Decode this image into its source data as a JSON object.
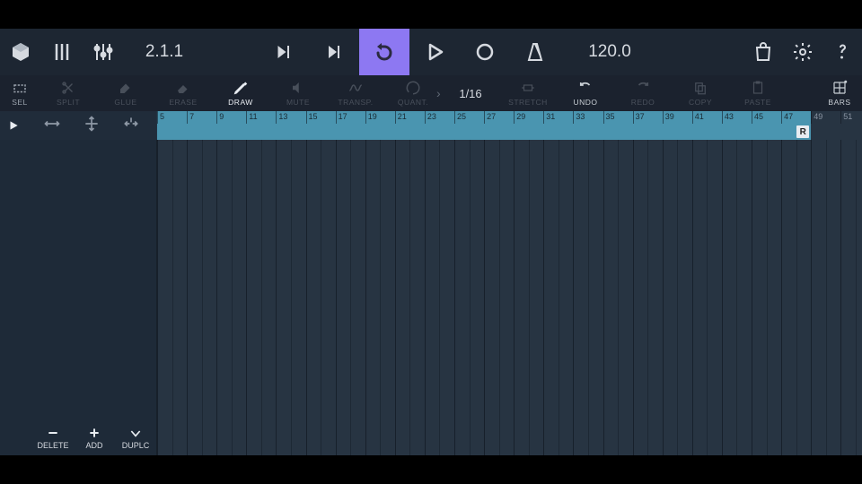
{
  "topbar": {
    "position": "2.1.1",
    "tempo": "120.0"
  },
  "tools": {
    "sel": "SEL",
    "split": "SPLIT",
    "glue": "GLUE",
    "erase": "ERASE",
    "draw": "DRAW",
    "mute": "MUTE",
    "transp": "TRANSP.",
    "quant": "QUANT.",
    "snap": "1/16",
    "stretch": "STRETCH",
    "undo": "UNDO",
    "redo": "REDO",
    "copy": "COPY",
    "paste": "PASTE",
    "bars": "BARS"
  },
  "ruler": {
    "labels": [
      "5",
      "7",
      "9",
      "11",
      "13",
      "15",
      "17",
      "19",
      "21",
      "23",
      "25",
      "27",
      "29",
      "31",
      "33",
      "35",
      "37",
      "39",
      "41",
      "43",
      "45",
      "47",
      "49",
      "51"
    ],
    "lightCount": 22,
    "barPx": 33.1
  },
  "loop": {
    "endLabel": "R"
  },
  "bottom": {
    "delete": "DELETE",
    "add": "ADD",
    "duplc": "DUPLC"
  }
}
